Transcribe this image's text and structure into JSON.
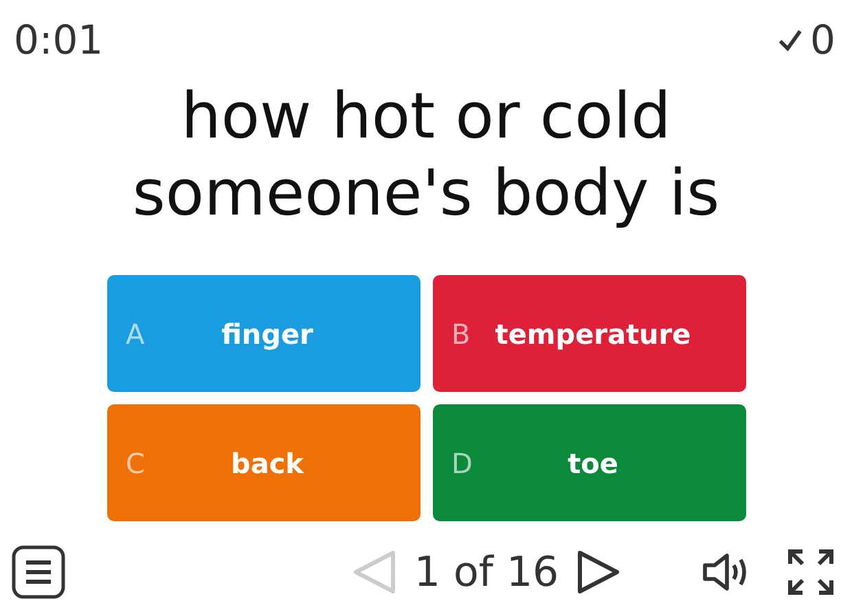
{
  "timer": "0:01",
  "score": "0",
  "question": "how hot or cold someone's body is",
  "answers": [
    {
      "letter": "A",
      "text": "finger",
      "color": "#1a9de0"
    },
    {
      "letter": "B",
      "text": "temperature",
      "color": "#de2038"
    },
    {
      "letter": "C",
      "text": "back",
      "color": "#f07008"
    },
    {
      "letter": "D",
      "text": "toe",
      "color": "#0a8a3a"
    }
  ],
  "pager": {
    "text": "1 of 16",
    "prev_disabled": true,
    "next_disabled": false
  }
}
